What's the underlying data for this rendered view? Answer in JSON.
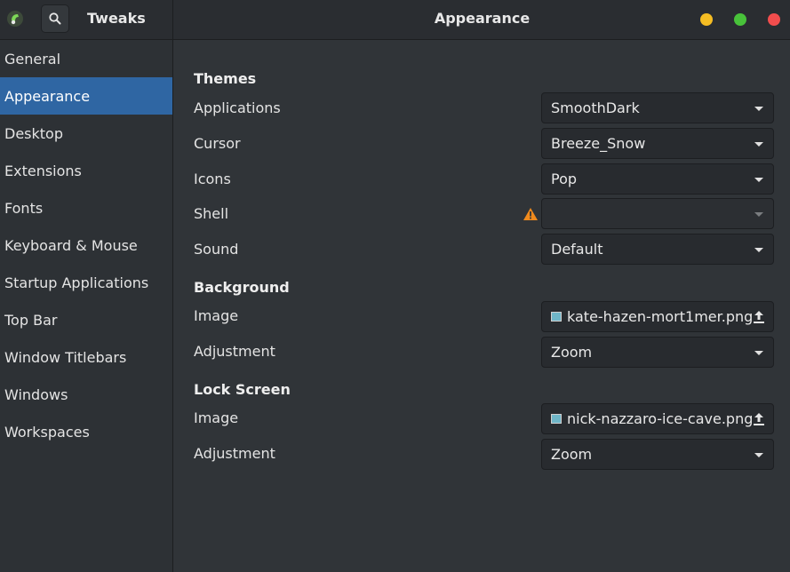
{
  "header": {
    "app_title": "Tweaks",
    "window_title": "Appearance",
    "colors": {
      "minimize": "#f5bd23",
      "maximize": "#48c23a",
      "close": "#f24d4d"
    }
  },
  "sidebar": {
    "items": [
      {
        "label": "General",
        "active": false
      },
      {
        "label": "Appearance",
        "active": true
      },
      {
        "label": "Desktop",
        "active": false
      },
      {
        "label": "Extensions",
        "active": false
      },
      {
        "label": "Fonts",
        "active": false
      },
      {
        "label": "Keyboard & Mouse",
        "active": false
      },
      {
        "label": "Startup Applications",
        "active": false
      },
      {
        "label": "Top Bar",
        "active": false
      },
      {
        "label": "Window Titlebars",
        "active": false
      },
      {
        "label": "Windows",
        "active": false
      },
      {
        "label": "Workspaces",
        "active": false
      }
    ],
    "active_color": "#2f66a3"
  },
  "themes": {
    "title": "Themes",
    "applications": {
      "label": "Applications",
      "value": "SmoothDark"
    },
    "cursor": {
      "label": "Cursor",
      "value": "Breeze_Snow"
    },
    "icons": {
      "label": "Icons",
      "value": "Pop"
    },
    "shell": {
      "label": "Shell",
      "value": "",
      "warning_icon": "warning-icon",
      "disabled": true
    },
    "sound": {
      "label": "Sound",
      "value": "Default"
    }
  },
  "background": {
    "title": "Background",
    "image": {
      "label": "Image",
      "value": "kate-hazen-mort1mer.png"
    },
    "adjustment": {
      "label": "Adjustment",
      "value": "Zoom"
    }
  },
  "lock_screen": {
    "title": "Lock Screen",
    "image": {
      "label": "Image",
      "value": "nick-nazzaro-ice-cave.png"
    },
    "adjustment": {
      "label": "Adjustment",
      "value": "Zoom"
    }
  }
}
